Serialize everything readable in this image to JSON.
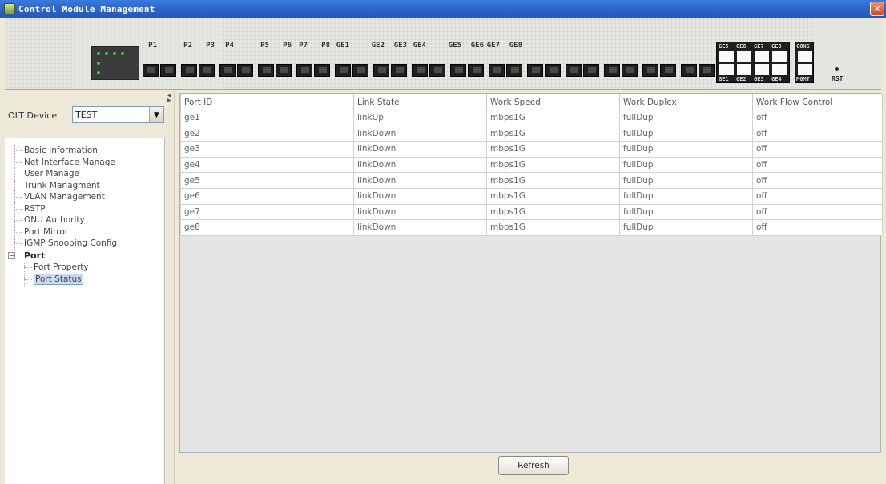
{
  "window": {
    "title": "Control Module Management",
    "close_glyph": "✕"
  },
  "device_panel": {
    "ports": [
      "P1",
      "P2",
      "P3",
      "P4",
      "P5",
      "P6",
      "P7",
      "P8",
      "GE1",
      "GE2",
      "GE3",
      "GE4",
      "GE5",
      "GE6",
      "GE7",
      "GE8"
    ],
    "sfp_top_labels": [
      "GE5",
      "GE6",
      "GE7",
      "GE8"
    ],
    "sfp_bottom_labels": [
      "GE1",
      "GE2",
      "GE3",
      "GE4"
    ],
    "console_label_top": "CONS",
    "console_label_bottom": "MGMT",
    "reset_label": "RST"
  },
  "sidebar": {
    "device_label": "OLT Device",
    "device_value": "TEST",
    "dropdown_glyph": "▼",
    "items": [
      {
        "label": "Basic Information"
      },
      {
        "label": "Net Interface Manage"
      },
      {
        "label": "User Manage"
      },
      {
        "label": "Trunk Managment"
      },
      {
        "label": "VLAN Management"
      },
      {
        "label": "RSTP"
      },
      {
        "label": "ONU Authority"
      },
      {
        "label": "Port Mirror"
      },
      {
        "label": "IGMP Snooping Config"
      }
    ],
    "node": {
      "label": "Port",
      "expander": "−"
    },
    "children": [
      {
        "label": "Port Property"
      },
      {
        "label": "Port Status"
      }
    ]
  },
  "table": {
    "columns": [
      "Port ID",
      "Link State",
      "Work Speed",
      "Work Duplex",
      "Work Flow Control"
    ],
    "rows": [
      [
        "ge1",
        "linkUp",
        "mbps1G",
        "fullDup",
        "off"
      ],
      [
        "ge2",
        "linkDown",
        "mbps1G",
        "fullDup",
        "off"
      ],
      [
        "ge3",
        "linkDown",
        "mbps1G",
        "fullDup",
        "off"
      ],
      [
        "ge4",
        "linkDown",
        "mbps1G",
        "fullDup",
        "off"
      ],
      [
        "ge5",
        "linkDown",
        "mbps1G",
        "fullDup",
        "off"
      ],
      [
        "ge6",
        "linkDown",
        "mbps1G",
        "fullDup",
        "off"
      ],
      [
        "ge7",
        "linkDown",
        "mbps1G",
        "fullDup",
        "off"
      ],
      [
        "ge8",
        "linkDown",
        "mbps1G",
        "fullDup",
        "off"
      ]
    ]
  },
  "actions": {
    "refresh_label": "Refresh"
  }
}
